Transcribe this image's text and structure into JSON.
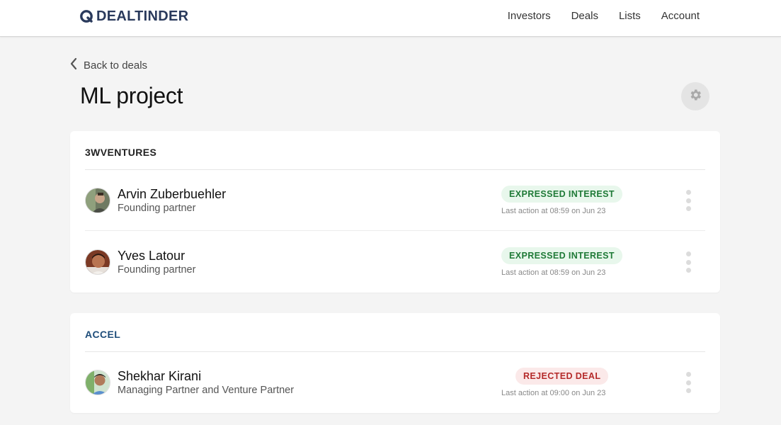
{
  "header": {
    "logo_text": "DEALTINDER",
    "nav": [
      {
        "label": "Investors"
      },
      {
        "label": "Deals"
      },
      {
        "label": "Lists"
      },
      {
        "label": "Account"
      }
    ]
  },
  "back_link": "Back to deals",
  "page_title": "ML project",
  "icons": {
    "logo": "logo-ring-icon",
    "back": "chevron-left-icon",
    "settings": "gear-icon",
    "row_menu": "vertical-dots-icon"
  },
  "colors": {
    "brand": "#2a3a5c",
    "accel_title": "#1e4d7a",
    "interest_bg": "#e8f7ec",
    "interest_text": "#1f7a37",
    "rejected_bg": "#fbe9e9",
    "rejected_text": "#b52a2a"
  },
  "groups": [
    {
      "name": "3WVENTURES",
      "investors": [
        {
          "name": "Arvin Zuberbuehler",
          "role": "Founding partner",
          "status": "EXPRESSED INTEREST",
          "last_action": "Last action at 08:59 on Jun 23"
        },
        {
          "name": "Yves Latour",
          "role": "Founding partner",
          "status": "EXPRESSED INTEREST",
          "last_action": "Last action at 08:59 on Jun 23"
        }
      ]
    },
    {
      "name": "ACCEL",
      "investors": [
        {
          "name": "Shekhar Kirani",
          "role": "Managing Partner and Venture Partner",
          "status": "REJECTED DEAL",
          "last_action": "Last action at 09:00 on Jun 23"
        }
      ]
    }
  ]
}
